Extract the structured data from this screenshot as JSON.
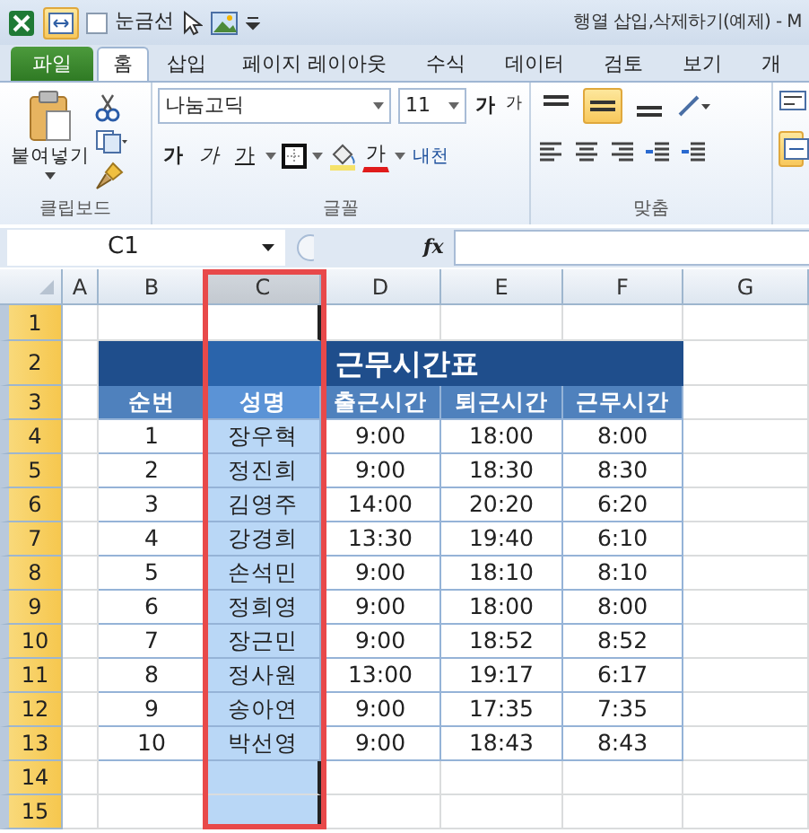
{
  "quick_access": {
    "gridlines": {
      "label": "눈금선",
      "checked": false
    }
  },
  "window_title": "행열 삽입,삭제하기(예제) - M",
  "ribbon_tabs": [
    {
      "label": "파일",
      "kind": "file",
      "selected": false
    },
    {
      "label": "홈",
      "kind": "tab",
      "selected": true
    },
    {
      "label": "삽입",
      "kind": "tab",
      "selected": false
    },
    {
      "label": "페이지 레이아웃",
      "kind": "tab",
      "selected": false
    },
    {
      "label": "수식",
      "kind": "tab",
      "selected": false
    },
    {
      "label": "데이터",
      "kind": "tab",
      "selected": false
    },
    {
      "label": "검토",
      "kind": "tab",
      "selected": false
    },
    {
      "label": "보기",
      "kind": "tab",
      "selected": false
    },
    {
      "label": "개",
      "kind": "tab",
      "selected": false
    }
  ],
  "ribbon": {
    "clipboard": {
      "paste_label": "붙여넣기",
      "group_label": "클립보드"
    },
    "font": {
      "font_name": "나눔고딕",
      "font_size": "11",
      "grow_label": "가",
      "shrink_label": "가",
      "bold_label": "가",
      "italic_label": "가",
      "underline_label": "가",
      "font_color_label": "가",
      "phonetic_label": "내천",
      "group_label": "글꼴"
    },
    "alignment": {
      "vertical_buttons": [
        {
          "kind": "top",
          "selected": false
        },
        {
          "kind": "middle",
          "selected": true
        },
        {
          "kind": "bottom",
          "selected": false
        }
      ],
      "merge_selected": true,
      "group_label": "맞춤"
    }
  },
  "formula_bar": {
    "name_box": "C1",
    "function_label": "fx"
  },
  "sheet": {
    "columns": [
      {
        "label": "A",
        "selected": false
      },
      {
        "label": "B",
        "selected": false
      },
      {
        "label": "C",
        "selected": true
      },
      {
        "label": "D",
        "selected": false
      },
      {
        "label": "E",
        "selected": false
      },
      {
        "label": "F",
        "selected": false
      },
      {
        "label": "G",
        "selected": false
      }
    ],
    "rows": [
      {
        "label": "1",
        "highlighted": true
      },
      {
        "label": "2",
        "highlighted": true
      },
      {
        "label": "3",
        "highlighted": true
      },
      {
        "label": "4",
        "highlighted": true
      },
      {
        "label": "5",
        "highlighted": true
      },
      {
        "label": "6",
        "highlighted": true
      },
      {
        "label": "7",
        "highlighted": true
      },
      {
        "label": "8",
        "highlighted": true
      },
      {
        "label": "9",
        "highlighted": true
      },
      {
        "label": "10",
        "highlighted": true
      },
      {
        "label": "11",
        "highlighted": true
      },
      {
        "label": "12",
        "highlighted": true
      },
      {
        "label": "13",
        "highlighted": true
      },
      {
        "label": "14",
        "highlighted": true
      },
      {
        "label": "15",
        "highlighted": true
      }
    ],
    "table": {
      "title": "근무시간표",
      "headers": [
        "순번",
        "성명",
        "출근시간",
        "퇴근시간",
        "근무시간"
      ],
      "rows": [
        [
          "1",
          "장우혁",
          "9:00",
          "18:00",
          "8:00"
        ],
        [
          "2",
          "정진희",
          "9:00",
          "18:30",
          "8:30"
        ],
        [
          "3",
          "김영주",
          "14:00",
          "20:20",
          "6:20"
        ],
        [
          "4",
          "강경희",
          "13:30",
          "19:40",
          "6:10"
        ],
        [
          "5",
          "손석민",
          "9:00",
          "18:10",
          "8:10"
        ],
        [
          "6",
          "정희영",
          "9:00",
          "18:00",
          "8:00"
        ],
        [
          "7",
          "장근민",
          "9:00",
          "18:52",
          "8:52"
        ],
        [
          "8",
          "정사원",
          "13:00",
          "19:17",
          "6:17"
        ],
        [
          "9",
          "송아연",
          "9:00",
          "17:35",
          "7:35"
        ],
        [
          "10",
          "박선영",
          "9:00",
          "18:43",
          "8:43"
        ]
      ]
    }
  }
}
